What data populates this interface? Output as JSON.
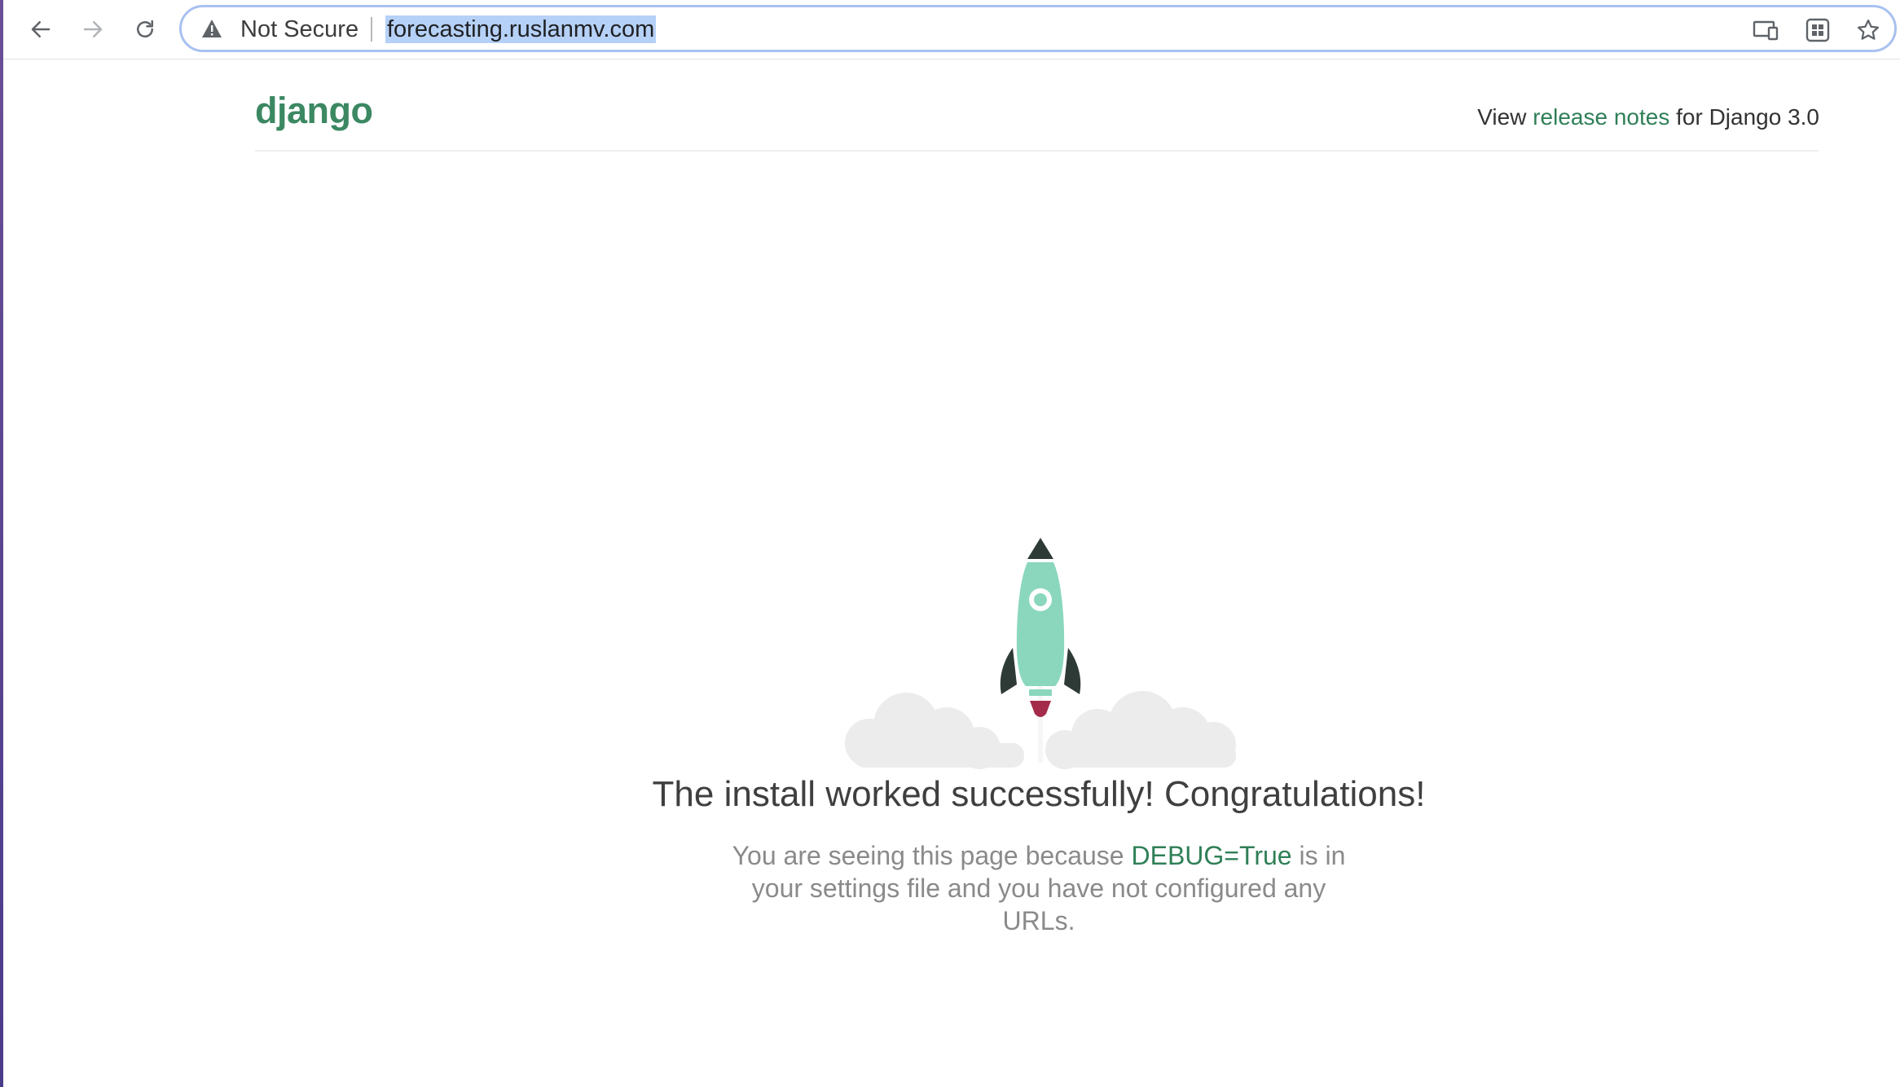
{
  "browser": {
    "security_label": "Not Secure",
    "url": "forecasting.ruslanmv.com",
    "icons": [
      "back-arrow-icon",
      "forward-arrow-icon",
      "reload-icon",
      "warning-triangle-icon",
      "cast-icon",
      "qr-code-icon",
      "bookmark-star-icon"
    ]
  },
  "header": {
    "logo": "django",
    "release_prefix": "View ",
    "release_link": "release notes",
    "release_suffix": " for Django 3.0"
  },
  "main": {
    "headline": "The install worked successfully! Congratulations!",
    "sub_prefix": "You are seeing this page because ",
    "sub_highlight": "DEBUG=True",
    "sub_suffix": " is in your settings file and you have not configured any URLs."
  },
  "colors": {
    "brand_green": "#3b8862",
    "link_green": "#2f7f57",
    "rocket_body": "#8ad7bd",
    "rocket_dark": "#2e3a36",
    "flame": "#a42c4a",
    "cloud": "#ececec",
    "url_selection": "#b6d1f7",
    "omnibox_focus": "#a8c1f0"
  }
}
